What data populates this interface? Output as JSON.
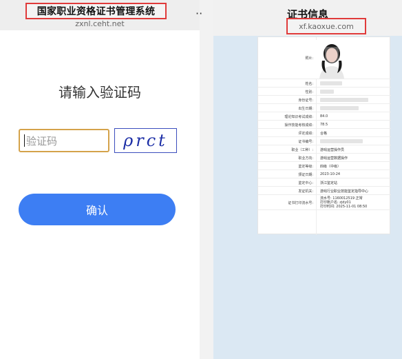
{
  "left": {
    "header": {
      "title": "国家职业资格证书管理系统",
      "url": "zxnl.ceht.net",
      "more": "··"
    },
    "prompt": "请输入验证码",
    "captcha": {
      "placeholder": "验证码",
      "image_text": "ρrct"
    },
    "confirm_label": "确认"
  },
  "right": {
    "header": {
      "title": "证书信息",
      "url": "xf.kaoxue.com"
    },
    "certificate": {
      "rows": [
        {
          "label": "照片:",
          "value": ""
        },
        {
          "label": "姓名:",
          "value": ""
        },
        {
          "label": "性别:",
          "value": ""
        },
        {
          "label": "身份证号:",
          "value": ""
        },
        {
          "label": "出生日期:",
          "value": ""
        },
        {
          "label": "理论知识考试成绩:",
          "value": "84.0"
        },
        {
          "label": "操作技能考核成绩:",
          "value": "78.5"
        },
        {
          "label": "评定成绩:",
          "value": "合格"
        },
        {
          "label": "证书编号:",
          "value": ""
        },
        {
          "label": "职业（工种）:",
          "value": "游戏运营操作员"
        },
        {
          "label": "职业方向:",
          "value": "游戏运营数据操作"
        },
        {
          "label": "鉴定等级:",
          "value": "四级（中级）"
        },
        {
          "label": "颁证日期:",
          "value": "2023-10-24"
        },
        {
          "label": "鉴定中心:",
          "value": "浙江鉴定站"
        },
        {
          "label": "发证机关:",
          "value": "游戏行业职业技能鉴定指导中心"
        },
        {
          "label": "证书打印流水号:",
          "value": "流水号: 1160012519 正常\n打印账户名: zjdy01\n打印时间: 2025-11-01 08:50"
        }
      ]
    }
  }
}
